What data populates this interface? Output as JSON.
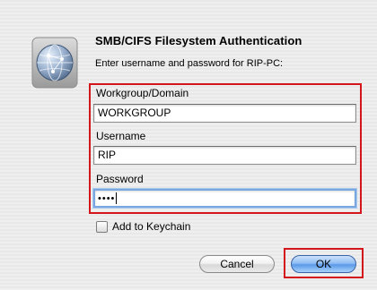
{
  "dialog": {
    "title": "SMB/CIFS Filesystem Authentication",
    "message": "Enter username and password for RIP-PC:"
  },
  "fields": {
    "workgroup": {
      "label": "Workgroup/Domain",
      "value": "WORKGROUP"
    },
    "username": {
      "label": "Username",
      "value": "RIP"
    },
    "password": {
      "label": "Password",
      "masked_value": "••••"
    }
  },
  "keychain": {
    "label": "Add to Keychain",
    "checked": false
  },
  "buttons": {
    "cancel": "Cancel",
    "ok": "OK"
  },
  "colors": {
    "highlight": "#d4161c",
    "default_button": "#5b9ae9"
  },
  "icons": {
    "dialog_icon": "network-globe-icon"
  }
}
